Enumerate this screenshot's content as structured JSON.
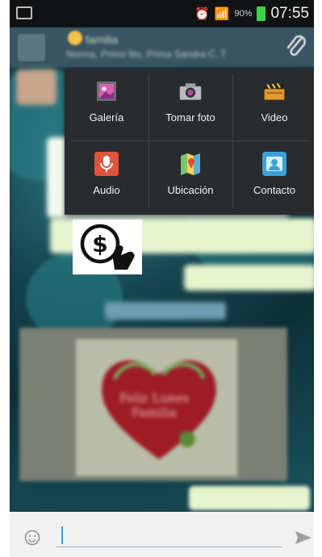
{
  "status_bar": {
    "time": "07:55",
    "battery_percent": "90%",
    "icons": [
      "gallery-notification-icon",
      "alarm-icon",
      "wifi-icon",
      "signal-icon",
      "battery-icon"
    ]
  },
  "header": {
    "title": "familia",
    "subtitle": "Norma, Primo lito, Prima Sandra C, T"
  },
  "attach_menu": {
    "items": [
      {
        "label": "Galería",
        "icon": "gallery-icon"
      },
      {
        "label": "Tomar foto",
        "icon": "camera-icon"
      },
      {
        "label": "Video",
        "icon": "video-clapper-icon"
      },
      {
        "label": "Audio",
        "icon": "microphone-icon"
      },
      {
        "label": "Ubicación",
        "icon": "map-icon"
      },
      {
        "label": "Contacto",
        "icon": "contact-card-icon"
      }
    ]
  },
  "photo_message": {
    "caption": "Feliz Lunes Familia"
  },
  "input": {
    "value": "",
    "placeholder": ""
  },
  "colors": {
    "accent": "#3aa6c8",
    "header_bg": "#3a5563",
    "menu_bg": "#282c2e",
    "battery": "#3bd14a"
  }
}
